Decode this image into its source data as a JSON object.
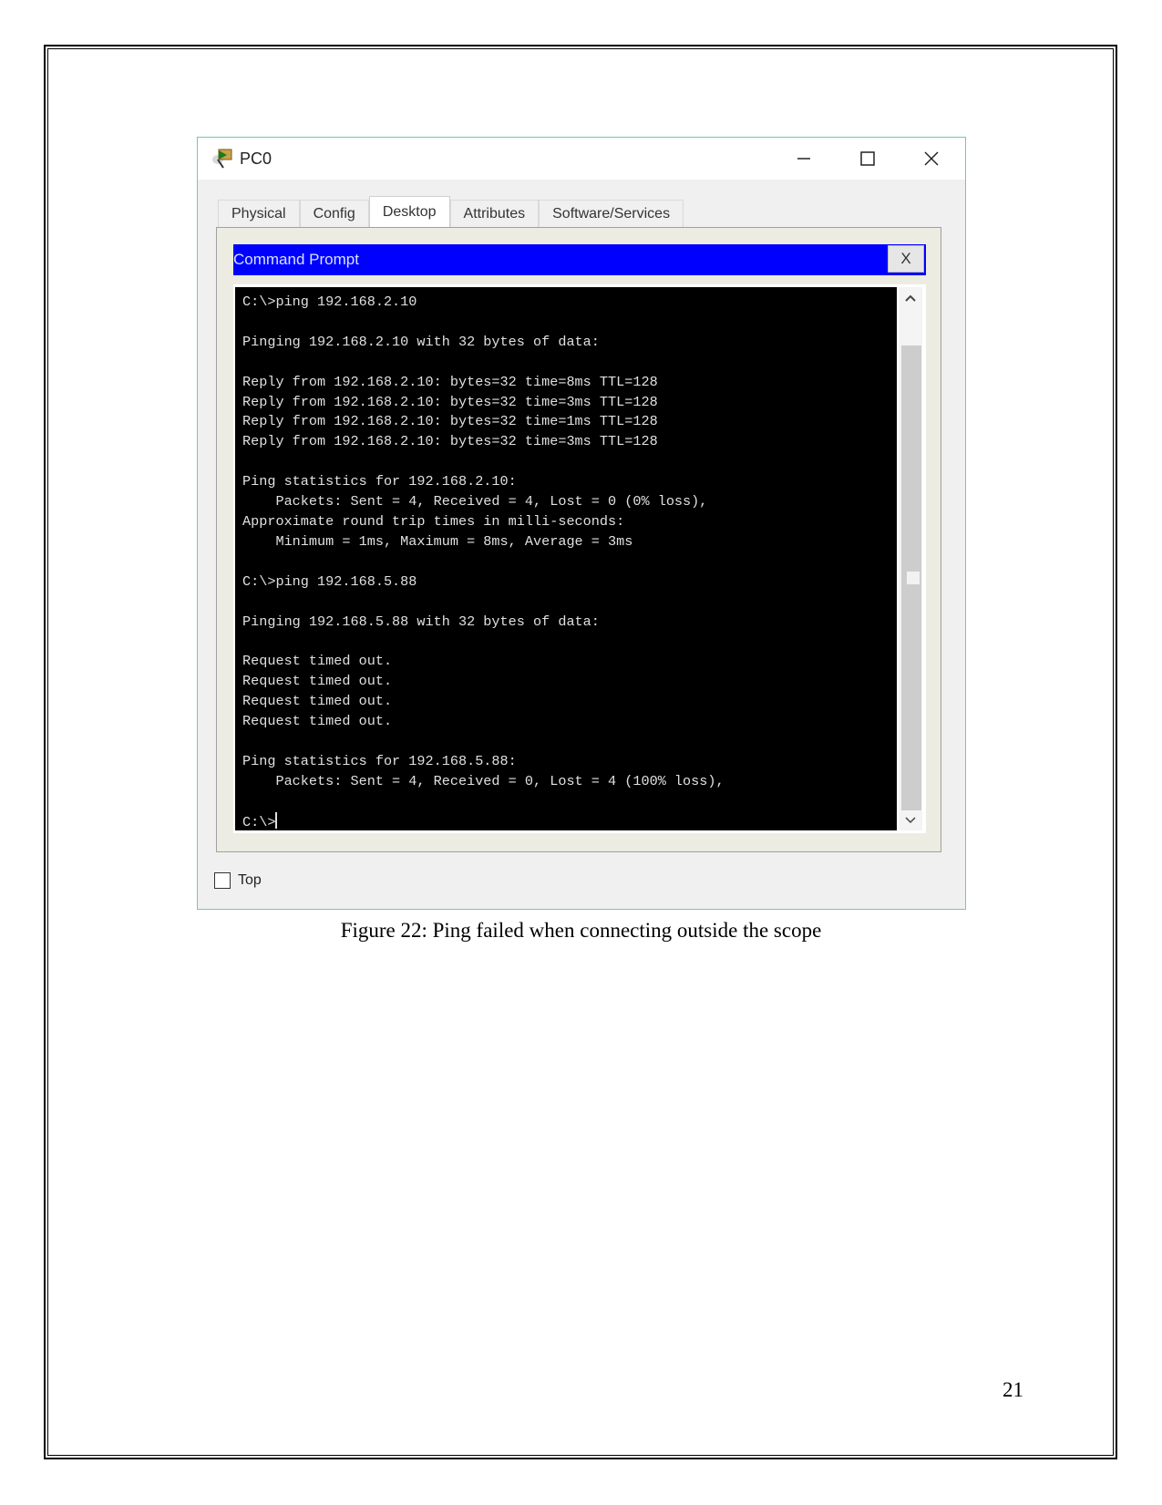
{
  "window": {
    "title": "PC0",
    "controls": {
      "minimize": "—",
      "maximize": "☐",
      "close": "✕"
    }
  },
  "tabs": [
    {
      "label": "Physical",
      "active": false
    },
    {
      "label": "Config",
      "active": false
    },
    {
      "label": "Desktop",
      "active": true
    },
    {
      "label": "Attributes",
      "active": false
    },
    {
      "label": "Software/Services",
      "active": false
    }
  ],
  "command_prompt": {
    "title": "Command Prompt",
    "close_label": "X",
    "lines": [
      "C:\\>ping 192.168.2.10",
      "",
      "Pinging 192.168.2.10 with 32 bytes of data:",
      "",
      "Reply from 192.168.2.10: bytes=32 time=8ms TTL=128",
      "Reply from 192.168.2.10: bytes=32 time=3ms TTL=128",
      "Reply from 192.168.2.10: bytes=32 time=1ms TTL=128",
      "Reply from 192.168.2.10: bytes=32 time=3ms TTL=128",
      "",
      "Ping statistics for 192.168.2.10:",
      "    Packets: Sent = 4, Received = 4, Lost = 0 (0% loss),",
      "Approximate round trip times in milli-seconds:",
      "    Minimum = 1ms, Maximum = 8ms, Average = 3ms",
      "",
      "C:\\>ping 192.168.5.88",
      "",
      "Pinging 192.168.5.88 with 32 bytes of data:",
      "",
      "Request timed out.",
      "Request timed out.",
      "Request timed out.",
      "Request timed out.",
      "",
      "Ping statistics for 192.168.5.88:",
      "    Packets: Sent = 4, Received = 0, Lost = 4 (100% loss),",
      ""
    ],
    "prompt": "C:\\>",
    "scroll_position": 0.5
  },
  "top_checkbox": {
    "label": "Top",
    "checked": false
  },
  "caption": "Figure 22: Ping failed when connecting outside the scope",
  "page_number": "21",
  "colors": {
    "cmd_header": "#0000ff",
    "terminal_bg": "#000000",
    "window_border": "#6fc9b5"
  }
}
